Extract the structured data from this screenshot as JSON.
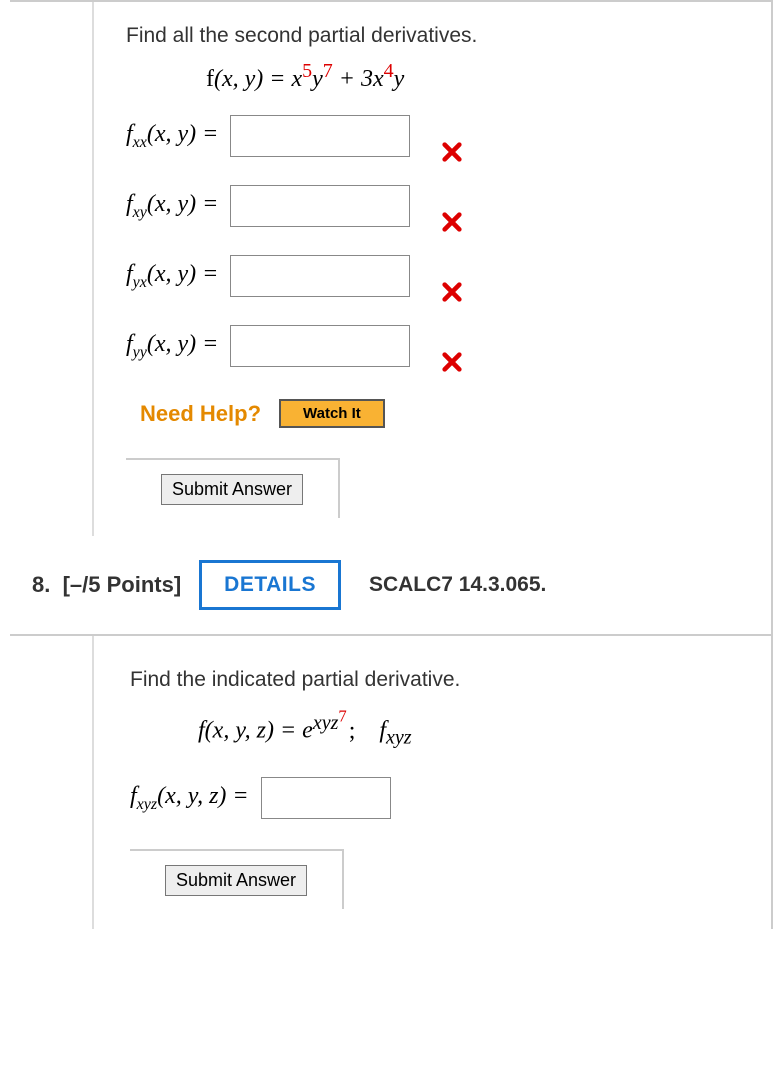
{
  "q1": {
    "prompt": "Find all the second partial derivatives.",
    "formula_html": "<span class='up'>f</span>(x, y) = x<sup><span class='red'>5</span></sup>y<sup><span class='red'>7</span></sup> + 3x<sup><span class='red'>4</span></sup>y",
    "rows": [
      {
        "label_html": "f<sub>xx</sub>(x, y) =",
        "status": "wrong"
      },
      {
        "label_html": "f<sub>xy</sub>(x, y) =",
        "status": "wrong"
      },
      {
        "label_html": "f<sub>yx</sub>(x, y) =",
        "status": "wrong"
      },
      {
        "label_html": "f<sub>yy</sub>(x, y) =",
        "status": "wrong"
      }
    ],
    "need_help": "Need Help?",
    "watch": "Watch It",
    "submit": "Submit Answer"
  },
  "q2": {
    "number": "8.",
    "points": "[–/5 Points]",
    "details": "DETAILS",
    "source": "SCALC7 14.3.065.",
    "prompt": "Find the indicated partial derivative.",
    "formula_html": "f(x, y, z) = e<sup>xyz<sup><span class='red'>7</span></sup></sup><span class='sep'>;</span>&nbsp;&nbsp;&nbsp;f<sub>xyz</sub>",
    "row_label_html": "f<sub>xyz</sub>(x, y, z) =",
    "submit": "Submit Answer"
  }
}
